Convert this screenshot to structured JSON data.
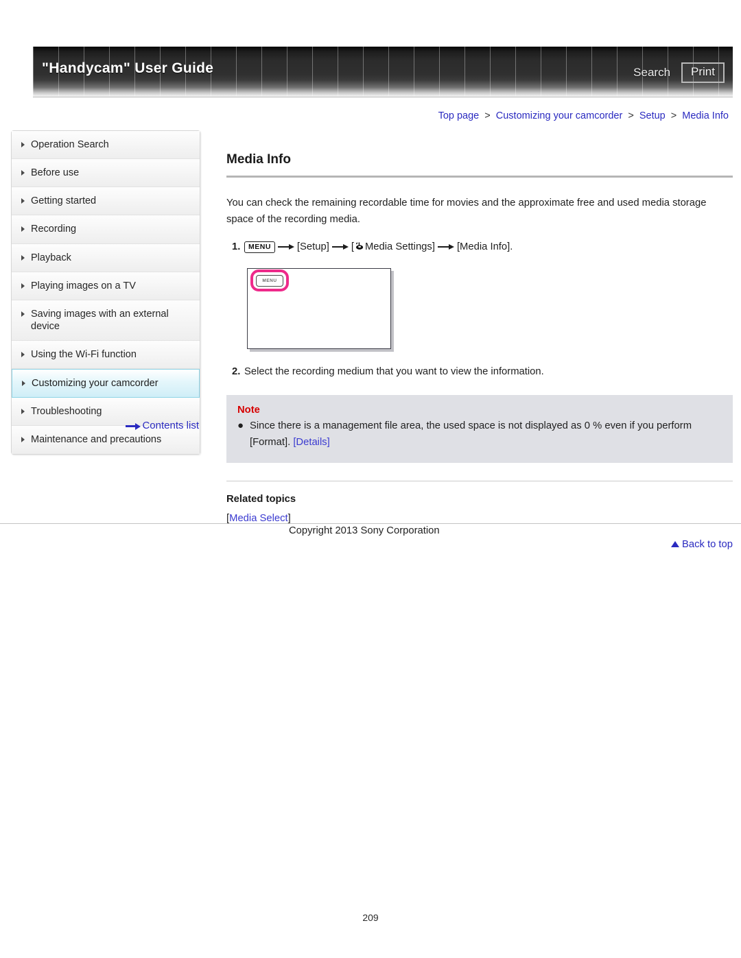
{
  "header": {
    "title": "\"Handycam\" User Guide",
    "search_label": "Search",
    "print_label": "Print"
  },
  "breadcrumb": {
    "items": [
      "Top page",
      "Customizing your camcorder",
      "Setup",
      "Media Info"
    ],
    "separator": ">"
  },
  "sidebar": {
    "items": [
      {
        "label": "Operation Search",
        "active": false
      },
      {
        "label": "Before use",
        "active": false
      },
      {
        "label": "Getting started",
        "active": false
      },
      {
        "label": "Recording",
        "active": false
      },
      {
        "label": "Playback",
        "active": false
      },
      {
        "label": "Playing images on a TV",
        "active": false
      },
      {
        "label": "Saving images with an external device",
        "active": false
      },
      {
        "label": "Using the Wi-Fi function",
        "active": false
      },
      {
        "label": "Customizing your camcorder",
        "active": true
      },
      {
        "label": "Troubleshooting",
        "active": false
      },
      {
        "label": "Maintenance and precautions",
        "active": false
      }
    ],
    "contents_list_label": "Contents list"
  },
  "main": {
    "title": "Media Info",
    "intro": "You can check the remaining recordable time for movies and the approximate free and used media storage space of the recording media.",
    "steps": [
      {
        "number": "1.",
        "menu_chip": "MENU",
        "part_setup": "[Setup]",
        "part_media_settings": "Media Settings]",
        "part_media_settings_open": "[",
        "part_media_info": "[Media Info]."
      },
      {
        "number": "2.",
        "text": "Select the recording medium that you want to view the information."
      }
    ],
    "figure": {
      "menu_button_label": "MENU",
      "highlight_color": "#ee2a8a"
    },
    "note": {
      "title": "Note",
      "bullet_glyph": "●",
      "text_before_link": "Since there is a management file area, the used space is not displayed as 0 % even if you perform [Format]. ",
      "link_label": "[Details]"
    },
    "related": {
      "title": "Related topics",
      "link_open": "[",
      "link_label": "Media Select",
      "link_close": "]"
    },
    "back_to_top_label": "Back to top"
  },
  "footer": {
    "copyright": "Copyright 2013 Sony Corporation",
    "page_number": "209"
  }
}
